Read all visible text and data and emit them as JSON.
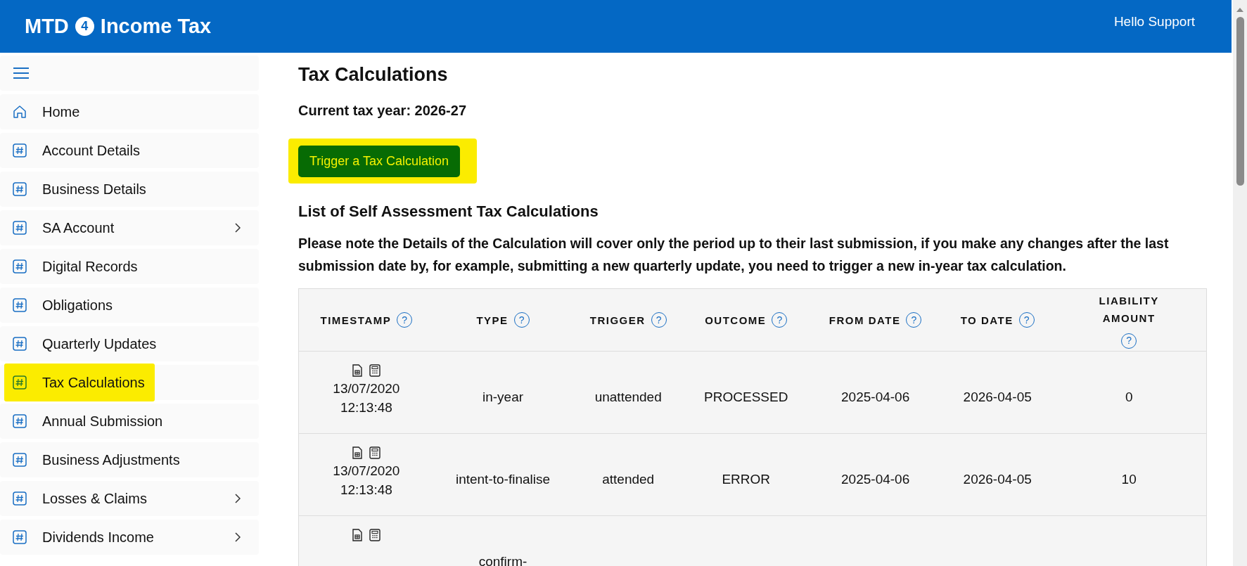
{
  "header": {
    "brand_left": "MTD",
    "brand_badge": "4",
    "brand_right": "Income Tax",
    "greeting": "Hello Support"
  },
  "sidebar": {
    "items": [
      {
        "label": "Home",
        "kind": "home",
        "selected": false,
        "expandable": false,
        "highlighted": false
      },
      {
        "label": "Account Details",
        "kind": "hash",
        "selected": false,
        "expandable": false,
        "highlighted": false
      },
      {
        "label": "Business Details",
        "kind": "hash",
        "selected": false,
        "expandable": false,
        "highlighted": false
      },
      {
        "label": "SA Account",
        "kind": "hash",
        "selected": false,
        "expandable": true,
        "highlighted": false
      },
      {
        "label": "Digital Records",
        "kind": "hash",
        "selected": false,
        "expandable": false,
        "highlighted": false
      },
      {
        "label": "Obligations",
        "kind": "hash",
        "selected": false,
        "expandable": false,
        "highlighted": false
      },
      {
        "label": "Quarterly Updates",
        "kind": "hash",
        "selected": false,
        "expandable": false,
        "highlighted": false
      },
      {
        "label": "Tax Calculations",
        "kind": "hash",
        "selected": true,
        "expandable": false,
        "highlighted": true
      },
      {
        "label": "Annual Submission",
        "kind": "hash",
        "selected": false,
        "expandable": false,
        "highlighted": false
      },
      {
        "label": "Business Adjustments",
        "kind": "hash",
        "selected": false,
        "expandable": false,
        "highlighted": false
      },
      {
        "label": "Losses & Claims",
        "kind": "hash",
        "selected": false,
        "expandable": true,
        "highlighted": false
      },
      {
        "label": "Dividends Income",
        "kind": "hash",
        "selected": false,
        "expandable": true,
        "highlighted": false
      }
    ]
  },
  "main": {
    "title": "Tax Calculations",
    "tax_year": "Current tax year: 2026-27",
    "trigger_button": {
      "label": "Trigger a Tax Calculation",
      "highlighted": true
    },
    "list_title": "List of Self Assessment Tax Calculations",
    "note": "Please note the Details of the Calculation will cover only the period up to their last submission, if you make any changes after the last submission date by, for example, submitting a new quarterly update, you need to trigger a new in-year tax calculation.",
    "table": {
      "columns": [
        {
          "label": "TIMESTAMP",
          "help": "?"
        },
        {
          "label": "TYPE",
          "help": "?"
        },
        {
          "label": "TRIGGER",
          "help": "?"
        },
        {
          "label": "OUTCOME",
          "help": "?"
        },
        {
          "label": "FROM DATE",
          "help": "?"
        },
        {
          "label": "TO DATE",
          "help": "?"
        },
        {
          "label": "LIABILITY AMOUNT",
          "help": "?"
        }
      ],
      "rows": [
        {
          "timestamp": "13/07/2020\n12:13:48",
          "type": "in-year",
          "trigger": "unattended",
          "outcome": "PROCESSED",
          "from_date": "2025-04-06",
          "to_date": "2026-04-05",
          "liability_amount": "0"
        },
        {
          "timestamp": "13/07/2020\n12:13:48",
          "type": "intent-to-finalise",
          "trigger": "attended",
          "outcome": "ERROR",
          "from_date": "2025-04-06",
          "to_date": "2026-04-05",
          "liability_amount": "10"
        },
        {
          "type": "confirm-"
        }
      ]
    }
  }
}
